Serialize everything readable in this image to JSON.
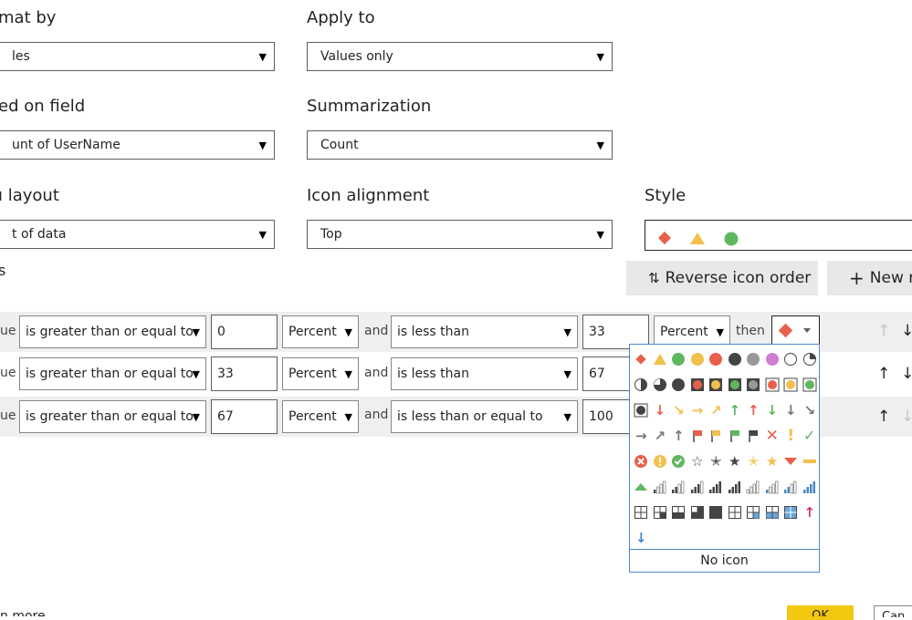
{
  "labels": {
    "format_by": "mat by",
    "apply_to": "Apply to",
    "based_on_field": "ed on field",
    "summarization": "Summarization",
    "icon_layout": "ı layout",
    "icon_alignment": "Icon alignment",
    "style": "Style",
    "rules": "s"
  },
  "dropdowns": {
    "format_by": "les",
    "apply_to": "Values only",
    "based_on_field": "unt of UserName",
    "summarization": "Count",
    "icon_layout": "t of data",
    "icon_alignment": "Top"
  },
  "buttons": {
    "reverse_icon_order": "Reverse icon order",
    "new_rule": "New ru",
    "ok": "OK",
    "cancel": "Can",
    "learn_more": "n more"
  },
  "rules": [
    {
      "prefix": "ue",
      "op1": "is greater than or equal to",
      "val1": "0",
      "unit1": "Percent",
      "and": "and",
      "op2": "is less than",
      "val2": "33",
      "unit2": "Percent",
      "then": "then"
    },
    {
      "prefix": "ue",
      "op1": "is greater than or equal to",
      "val1": "33",
      "unit1": "Percent",
      "and": "and",
      "op2": "is less than",
      "val2": "67"
    },
    {
      "prefix": "ue",
      "op1": "is greater than or equal to",
      "val1": "67",
      "unit1": "Percent",
      "and": "and",
      "op2": "is less than or equal to",
      "val2": "100"
    }
  ],
  "picker": {
    "no_icon_label": "No icon"
  },
  "colors": {
    "red": "#e8604c",
    "yellow": "#f2c04d",
    "green": "#5fb760",
    "dark": "#444444",
    "grey": "#999999",
    "purple": "#d07fd0",
    "blue": "#4a87c8",
    "ok_yellow": "#f2c811"
  }
}
